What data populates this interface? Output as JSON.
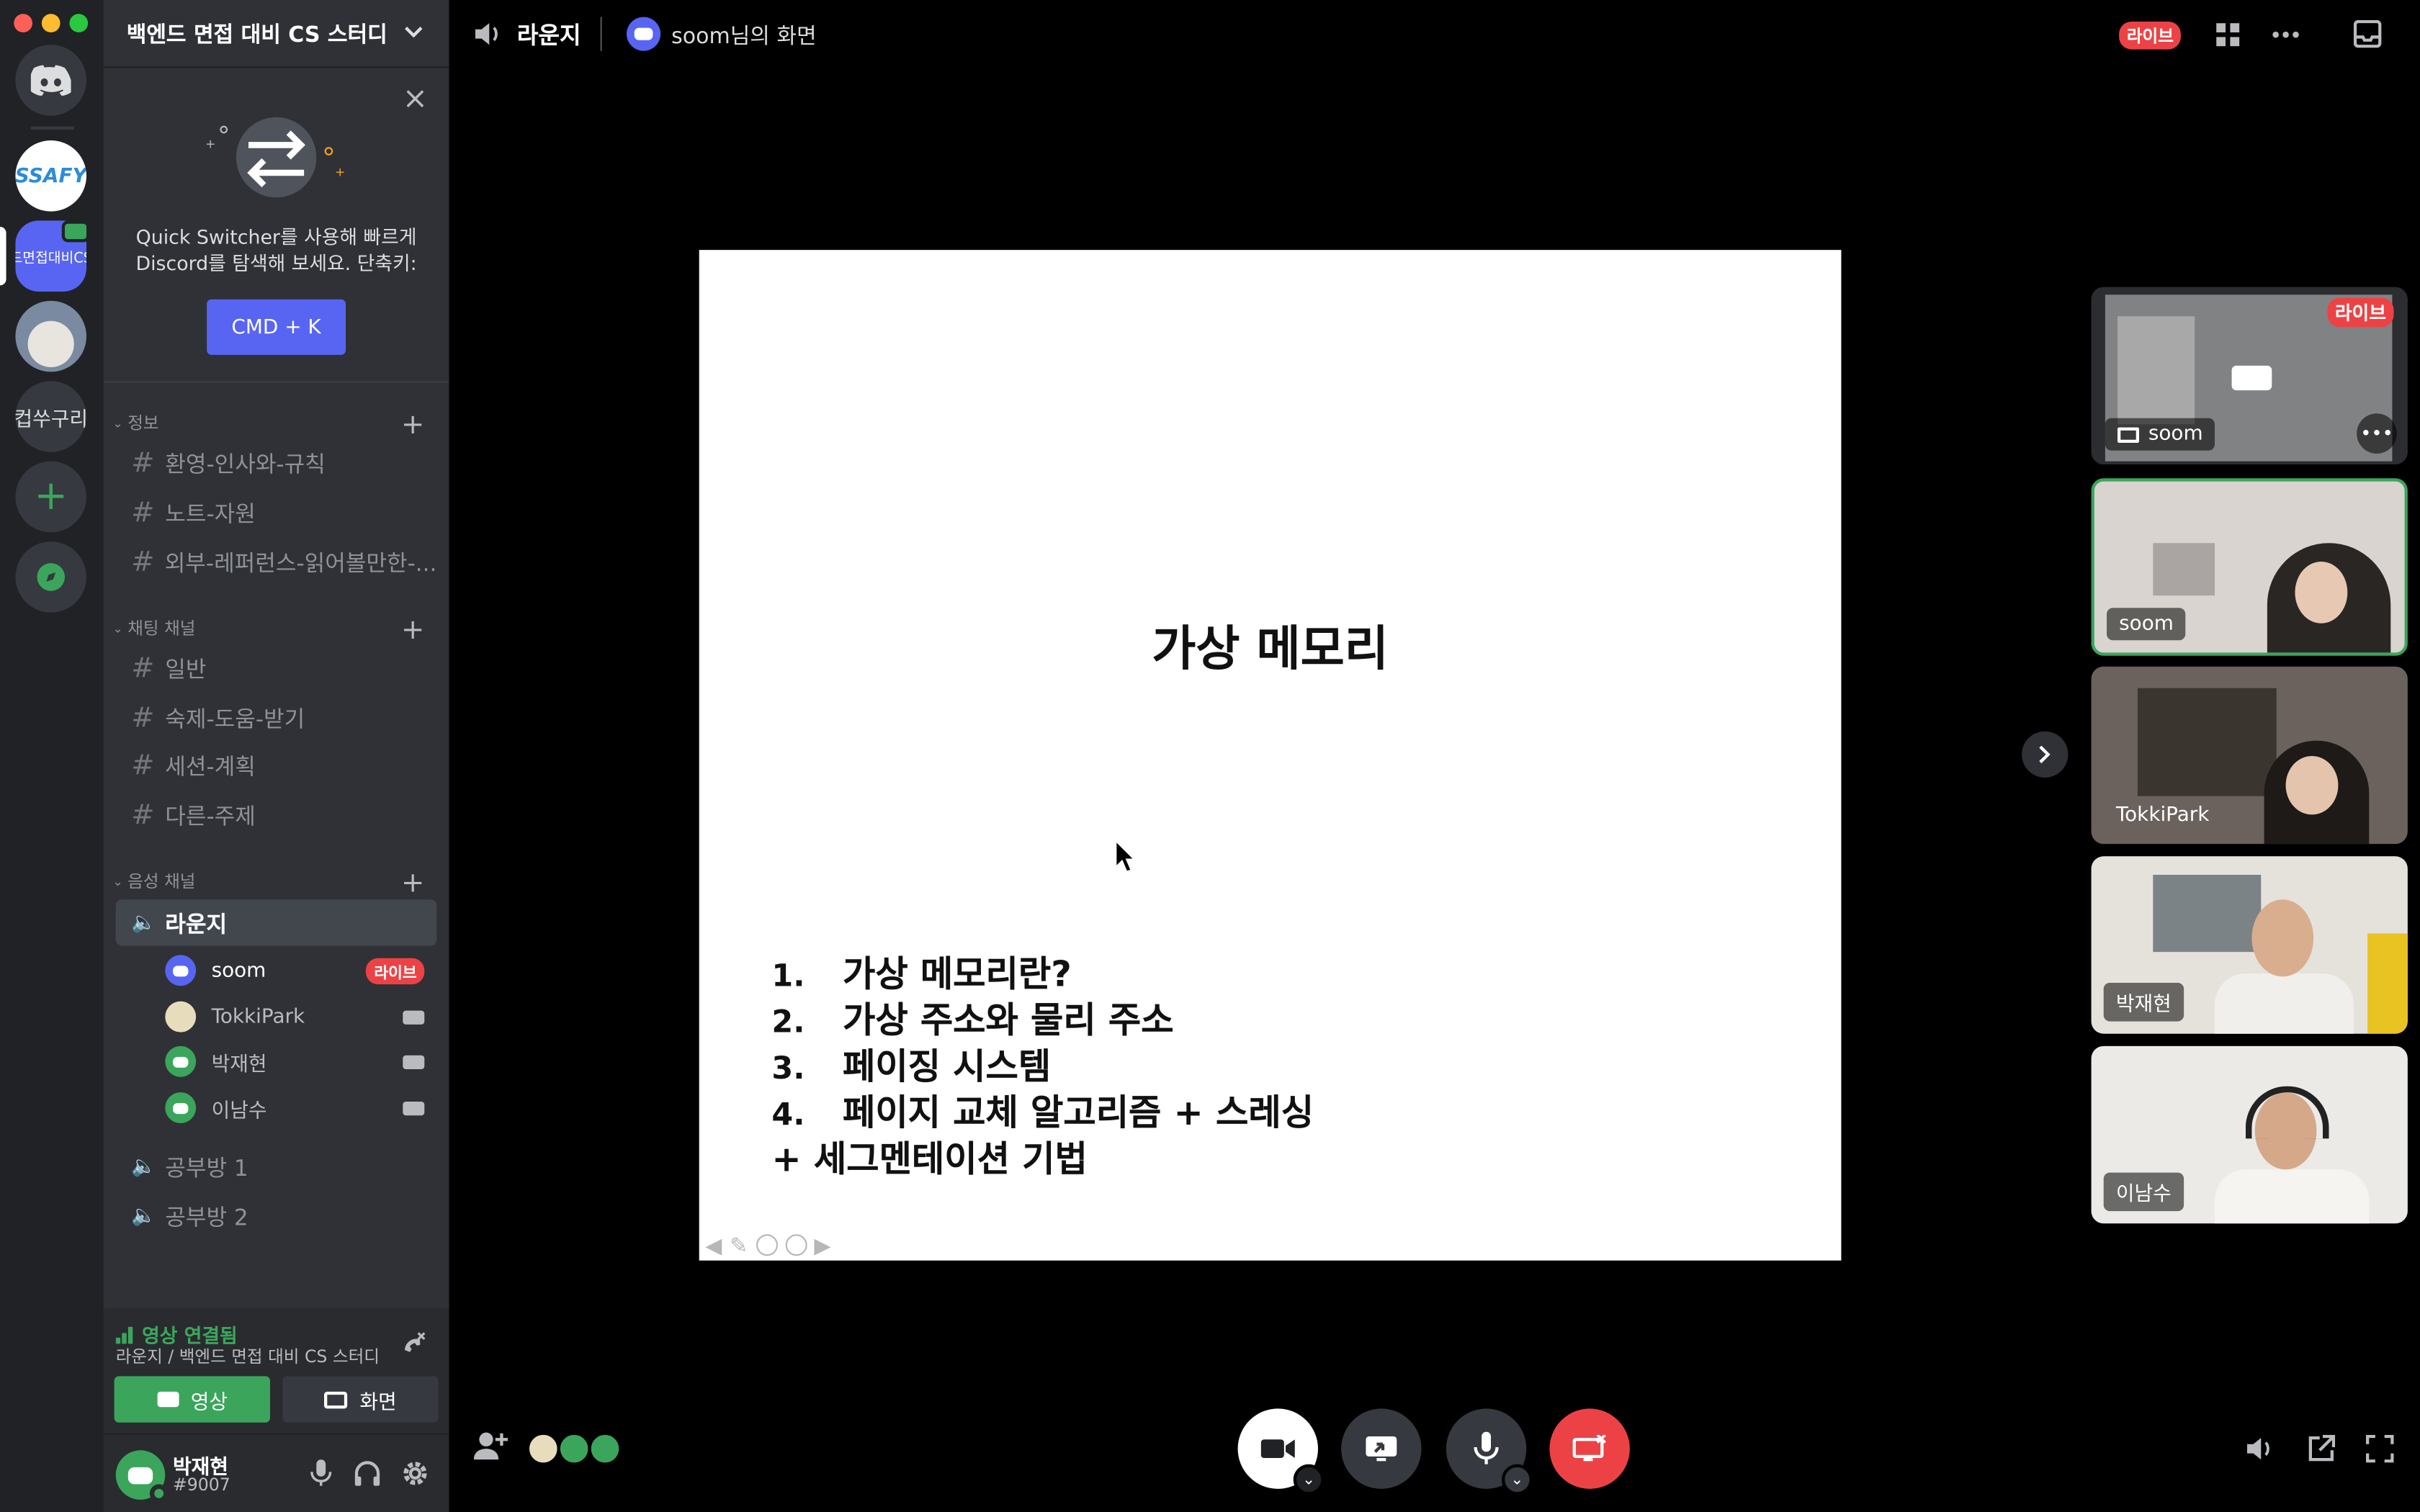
{
  "server": {
    "name": "백엔드 면접 대비 CS 스터디"
  },
  "rail": {
    "ssafy_label": "SSAFY",
    "active_label": "드면접대비CS",
    "text_server": "컵쑤구리"
  },
  "quick_switcher": {
    "text": "Quick Switcher를 사용해 빠르게 Discord를 탐색해 보세요. 단축키:",
    "button": "CMD + K"
  },
  "categories": {
    "info": {
      "label": "정보",
      "channels": [
        "환영-인사와-규칙",
        "노트-자원",
        "외부-레퍼런스-읽어볼만한-..."
      ]
    },
    "text": {
      "label": "채팅 채널",
      "channels": [
        "일반",
        "숙제-도움-받기",
        "세션-계획",
        "다른-주제"
      ]
    },
    "voice": {
      "label": "음성 채널"
    }
  },
  "voice": {
    "active_channel": "라운지",
    "users": [
      "soom",
      "TokkiPark",
      "박재현",
      "이남수"
    ],
    "other_channels": [
      "공부방 1",
      "공부방 2"
    ],
    "live_badge": "라이브"
  },
  "connection": {
    "status": "영상 연결됨",
    "location": "라운지 / 백엔드 면접 대비 CS 스터디",
    "video_label": "영상",
    "screen_label": "화면"
  },
  "user": {
    "name": "박재현",
    "tag": "#9007"
  },
  "topbar": {
    "channel": "라운지",
    "stream": "soom님의 화면",
    "live": "라이브"
  },
  "slide": {
    "title": "가상 메모리",
    "items": [
      {
        "num": "1.",
        "text": "가상 메모리란?"
      },
      {
        "num": "2.",
        "text": "가상 주소와 물리 주소"
      },
      {
        "num": "3.",
        "text": "페이징 시스템"
      },
      {
        "num": "4.",
        "text": "페이지 교체 알고리즘 + 스레싱"
      }
    ],
    "extra": "+ 세그멘테이션 기법"
  },
  "tiles": [
    {
      "label": "soom",
      "live": "라이브"
    },
    {
      "label": "soom"
    },
    {
      "label": "TokkiPark"
    },
    {
      "label": "박재현"
    },
    {
      "label": "이남수"
    }
  ],
  "colors": {
    "accent": "#5865f2",
    "green": "#3ba55c",
    "red": "#ed4245"
  }
}
